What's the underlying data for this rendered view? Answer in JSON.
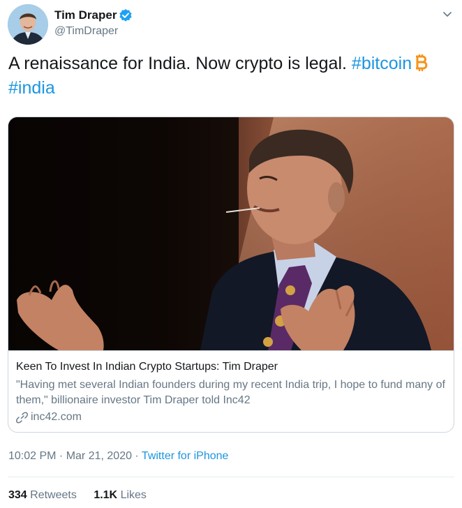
{
  "author": {
    "name": "Tim Draper",
    "handle": "@TimDraper"
  },
  "tweet": {
    "text": "A renaissance for India. Now crypto is legal.",
    "hashtag_bitcoin": "#bitcoin",
    "hashtag_india": "#india"
  },
  "card": {
    "title": "Keen To Invest In Indian Crypto Startups: Tim Draper",
    "description": "\"Having met several Indian founders during my recent India trip, I hope to fund many of them,\" billionaire investor Tim Draper told Inc42",
    "domain": "inc42.com"
  },
  "meta": {
    "time": "10:02 PM",
    "separator": " · ",
    "date": "Mar 21, 2020",
    "source": "Twitter for iPhone"
  },
  "stats": {
    "retweets_count": "334",
    "retweets_label": "Retweets",
    "likes_count": "1.1K",
    "likes_label": "Likes"
  },
  "colors": {
    "link": "#1b95e0",
    "secondary_text": "#657786",
    "bitcoin_orange": "#f7931a"
  },
  "icons": [
    "avatar",
    "verified-badge-icon",
    "chevron-down-icon",
    "bitcoin-emoji-icon",
    "link-icon"
  ]
}
